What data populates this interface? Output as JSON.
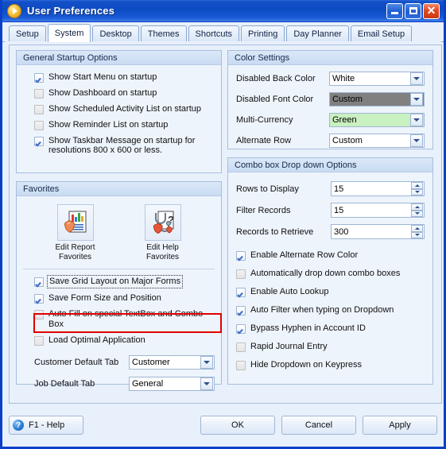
{
  "window": {
    "title": "User Preferences",
    "icon": "orange-arrow-icon",
    "minimize_label": "Minimize",
    "maximize_label": "Maximize",
    "close_label": "Close"
  },
  "tabs": [
    {
      "label": "Setup",
      "active": false
    },
    {
      "label": "System",
      "active": true
    },
    {
      "label": "Desktop",
      "active": false
    },
    {
      "label": "Themes",
      "active": false
    },
    {
      "label": "Shortcuts",
      "active": false
    },
    {
      "label": "Printing",
      "active": false
    },
    {
      "label": "Day Planner",
      "active": false
    },
    {
      "label": "Email Setup",
      "active": false
    }
  ],
  "general_startup": {
    "title": "General Startup Options",
    "options": [
      {
        "label": "Show Start Menu on startup",
        "checked": true
      },
      {
        "label": "Show Dashboard on startup",
        "checked": false
      },
      {
        "label": "Show Scheduled Activity List on startup",
        "checked": false
      },
      {
        "label": "Show Reminder List on startup",
        "checked": false
      },
      {
        "label": "Show Taskbar Message on startup for resolutions 800 x 600 or less.",
        "checked": true
      }
    ]
  },
  "favorites": {
    "title": "Favorites",
    "buttons": [
      {
        "caption_line1": "Edit Report",
        "caption_line2": "Favorites",
        "icon": "report-chart-icon"
      },
      {
        "caption_line1": "Edit Help",
        "caption_line2": "Favorites",
        "icon": "help-stethoscope-icon"
      }
    ],
    "options": [
      {
        "label": "Save Grid Layout on Major Forms",
        "checked": true,
        "focused": true,
        "highlighted": true
      },
      {
        "label": "Save Form Size and Position",
        "checked": true,
        "focused": false,
        "highlighted": false
      },
      {
        "label": "Auto Fill on special TextBox and Combo Box",
        "checked": false,
        "focused": false,
        "highlighted": false
      },
      {
        "label": "Load Optimal Application",
        "checked": false,
        "focused": false,
        "highlighted": false
      }
    ],
    "selects": [
      {
        "label": "Customer Default Tab",
        "value": "Customer"
      },
      {
        "label": "Job Default Tab",
        "value": "General"
      }
    ]
  },
  "color_settings": {
    "title": "Color Settings",
    "rows": [
      {
        "label": "Disabled Back Color",
        "value": "White",
        "bg": "#ffffff",
        "fg": "#000000"
      },
      {
        "label": "Disabled Font Color",
        "value": "Custom",
        "bg": "#808080",
        "fg": "#000000"
      },
      {
        "label": "Multi-Currency",
        "value": "Green",
        "bg": "#c9f0c0",
        "fg": "#000000"
      },
      {
        "label": "Alternate Row",
        "value": "Custom",
        "bg": "#ffffff",
        "fg": "#000000"
      }
    ]
  },
  "combo_options": {
    "title": "Combo box Drop down Options",
    "spinners": [
      {
        "label": "Rows to Display",
        "value": "15"
      },
      {
        "label": "Filter Records",
        "value": "15"
      },
      {
        "label": "Records to Retrieve",
        "value": "300"
      }
    ],
    "checkboxes": [
      {
        "label": "Enable Alternate Row Color",
        "checked": true
      },
      {
        "label": "Automatically drop down combo boxes",
        "checked": false
      },
      {
        "label": "Enable Auto Lookup",
        "checked": true
      },
      {
        "label": "Auto Filter when typing on Dropdown",
        "checked": true
      },
      {
        "label": "Bypass Hyphen in Account ID",
        "checked": true
      },
      {
        "label": "Rapid Journal Entry",
        "checked": false
      },
      {
        "label": "Hide Dropdown on Keypress",
        "checked": false
      }
    ]
  },
  "footer": {
    "help_label": "F1 - Help",
    "help_glyph": "?",
    "ok_label": "OK",
    "cancel_label": "Cancel",
    "apply_label": "Apply"
  },
  "colors": {
    "titlebar_blue": "#0d4bc4",
    "border_blue": "#0a3fc8",
    "panel_bg": "#e8f0fb",
    "highlight_red": "#e00000",
    "check_blue": "#3a6bc4"
  }
}
